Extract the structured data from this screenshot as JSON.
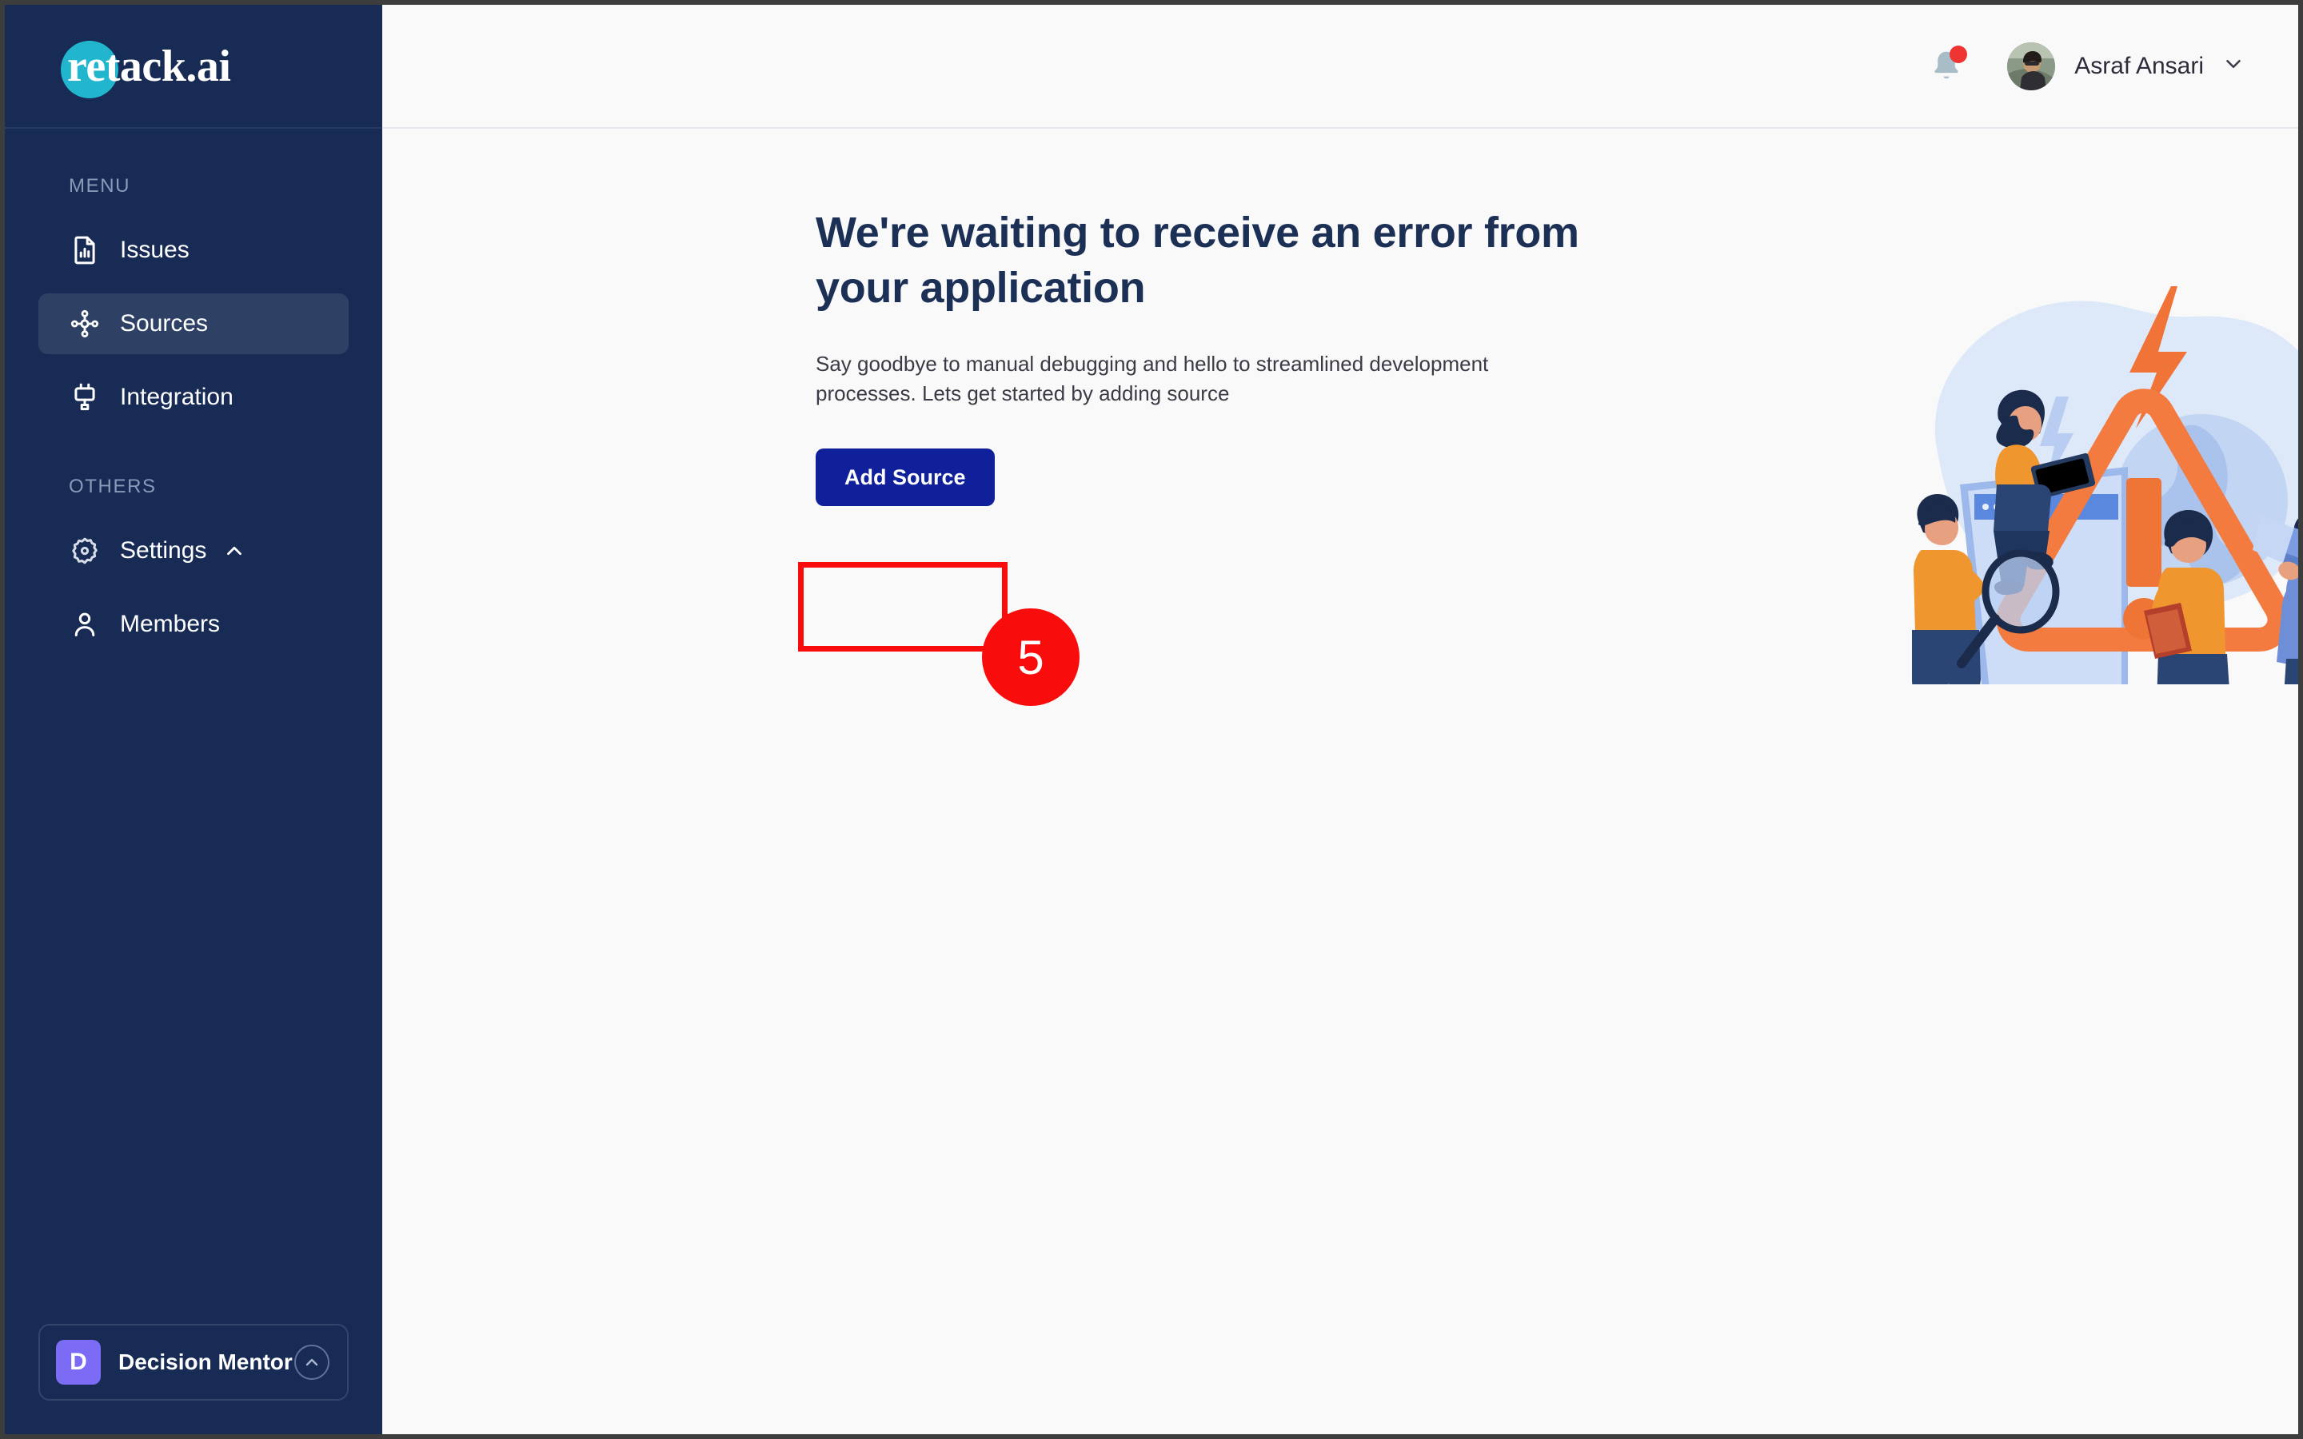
{
  "app": {
    "logo_text_accent": "re",
    "logo_text_rest": "tack.ai",
    "brand_teal": "#21b6ce",
    "sidebar_bg": "#182b55",
    "accent_blue": "#10209a",
    "annotation_red": "#f90c0c"
  },
  "sidebar": {
    "sections": [
      {
        "label": "MENU"
      },
      {
        "label": "OTHERS"
      }
    ],
    "menu_items": [
      {
        "label": "Issues",
        "icon": "document-chart-icon",
        "active": false
      },
      {
        "label": "Sources",
        "icon": "network-nodes-icon",
        "active": true
      },
      {
        "label": "Integration",
        "icon": "plug-icon",
        "active": false
      }
    ],
    "others_items": [
      {
        "label": "Settings",
        "icon": "gear-icon",
        "chevron": "chevron-up-icon"
      },
      {
        "label": "Members",
        "icon": "person-icon",
        "chevron": ""
      }
    ],
    "workspace": {
      "initial": "D",
      "name": "Decision Mentor",
      "toggle_icon": "chevron-up-circle-icon",
      "avatar_color": "#7c6cf5"
    }
  },
  "topbar": {
    "notification_icon": "bell-icon",
    "has_unread": true,
    "user_name": "Asraf Ansari",
    "user_menu_icon": "chevron-down-icon",
    "avatar_icon": "user-avatar"
  },
  "content": {
    "heading": "We're waiting to receive an error from your application",
    "subtext": "Say goodbye to manual debugging and hello to streamlined development processes. Lets get started by adding source",
    "primary_button": "Add Source",
    "illustration_name": "error-warning-illustration"
  },
  "annotation": {
    "step_number": "5",
    "target": "add-source-button"
  }
}
